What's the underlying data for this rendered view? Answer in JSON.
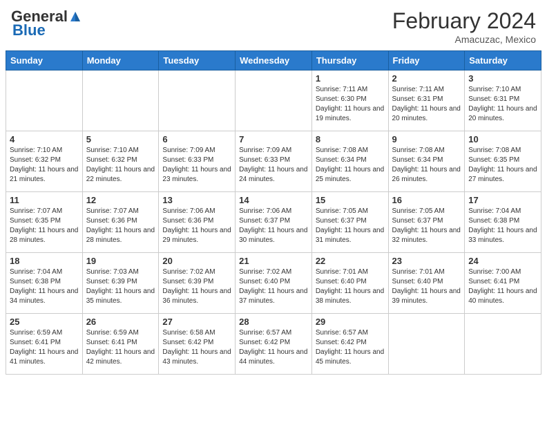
{
  "header": {
    "logo_general": "General",
    "logo_blue": "Blue",
    "title": "February 2024",
    "location": "Amacuzac, Mexico"
  },
  "days_of_week": [
    "Sunday",
    "Monday",
    "Tuesday",
    "Wednesday",
    "Thursday",
    "Friday",
    "Saturday"
  ],
  "weeks": [
    [
      {
        "day": "",
        "info": ""
      },
      {
        "day": "",
        "info": ""
      },
      {
        "day": "",
        "info": ""
      },
      {
        "day": "",
        "info": ""
      },
      {
        "day": "1",
        "info": "Sunrise: 7:11 AM\nSunset: 6:30 PM\nDaylight: 11 hours and 19 minutes."
      },
      {
        "day": "2",
        "info": "Sunrise: 7:11 AM\nSunset: 6:31 PM\nDaylight: 11 hours and 20 minutes."
      },
      {
        "day": "3",
        "info": "Sunrise: 7:10 AM\nSunset: 6:31 PM\nDaylight: 11 hours and 20 minutes."
      }
    ],
    [
      {
        "day": "4",
        "info": "Sunrise: 7:10 AM\nSunset: 6:32 PM\nDaylight: 11 hours and 21 minutes."
      },
      {
        "day": "5",
        "info": "Sunrise: 7:10 AM\nSunset: 6:32 PM\nDaylight: 11 hours and 22 minutes."
      },
      {
        "day": "6",
        "info": "Sunrise: 7:09 AM\nSunset: 6:33 PM\nDaylight: 11 hours and 23 minutes."
      },
      {
        "day": "7",
        "info": "Sunrise: 7:09 AM\nSunset: 6:33 PM\nDaylight: 11 hours and 24 minutes."
      },
      {
        "day": "8",
        "info": "Sunrise: 7:08 AM\nSunset: 6:34 PM\nDaylight: 11 hours and 25 minutes."
      },
      {
        "day": "9",
        "info": "Sunrise: 7:08 AM\nSunset: 6:34 PM\nDaylight: 11 hours and 26 minutes."
      },
      {
        "day": "10",
        "info": "Sunrise: 7:08 AM\nSunset: 6:35 PM\nDaylight: 11 hours and 27 minutes."
      }
    ],
    [
      {
        "day": "11",
        "info": "Sunrise: 7:07 AM\nSunset: 6:35 PM\nDaylight: 11 hours and 28 minutes."
      },
      {
        "day": "12",
        "info": "Sunrise: 7:07 AM\nSunset: 6:36 PM\nDaylight: 11 hours and 28 minutes."
      },
      {
        "day": "13",
        "info": "Sunrise: 7:06 AM\nSunset: 6:36 PM\nDaylight: 11 hours and 29 minutes."
      },
      {
        "day": "14",
        "info": "Sunrise: 7:06 AM\nSunset: 6:37 PM\nDaylight: 11 hours and 30 minutes."
      },
      {
        "day": "15",
        "info": "Sunrise: 7:05 AM\nSunset: 6:37 PM\nDaylight: 11 hours and 31 minutes."
      },
      {
        "day": "16",
        "info": "Sunrise: 7:05 AM\nSunset: 6:37 PM\nDaylight: 11 hours and 32 minutes."
      },
      {
        "day": "17",
        "info": "Sunrise: 7:04 AM\nSunset: 6:38 PM\nDaylight: 11 hours and 33 minutes."
      }
    ],
    [
      {
        "day": "18",
        "info": "Sunrise: 7:04 AM\nSunset: 6:38 PM\nDaylight: 11 hours and 34 minutes."
      },
      {
        "day": "19",
        "info": "Sunrise: 7:03 AM\nSunset: 6:39 PM\nDaylight: 11 hours and 35 minutes."
      },
      {
        "day": "20",
        "info": "Sunrise: 7:02 AM\nSunset: 6:39 PM\nDaylight: 11 hours and 36 minutes."
      },
      {
        "day": "21",
        "info": "Sunrise: 7:02 AM\nSunset: 6:40 PM\nDaylight: 11 hours and 37 minutes."
      },
      {
        "day": "22",
        "info": "Sunrise: 7:01 AM\nSunset: 6:40 PM\nDaylight: 11 hours and 38 minutes."
      },
      {
        "day": "23",
        "info": "Sunrise: 7:01 AM\nSunset: 6:40 PM\nDaylight: 11 hours and 39 minutes."
      },
      {
        "day": "24",
        "info": "Sunrise: 7:00 AM\nSunset: 6:41 PM\nDaylight: 11 hours and 40 minutes."
      }
    ],
    [
      {
        "day": "25",
        "info": "Sunrise: 6:59 AM\nSunset: 6:41 PM\nDaylight: 11 hours and 41 minutes."
      },
      {
        "day": "26",
        "info": "Sunrise: 6:59 AM\nSunset: 6:41 PM\nDaylight: 11 hours and 42 minutes."
      },
      {
        "day": "27",
        "info": "Sunrise: 6:58 AM\nSunset: 6:42 PM\nDaylight: 11 hours and 43 minutes."
      },
      {
        "day": "28",
        "info": "Sunrise: 6:57 AM\nSunset: 6:42 PM\nDaylight: 11 hours and 44 minutes."
      },
      {
        "day": "29",
        "info": "Sunrise: 6:57 AM\nSunset: 6:42 PM\nDaylight: 11 hours and 45 minutes."
      },
      {
        "day": "",
        "info": ""
      },
      {
        "day": "",
        "info": ""
      }
    ]
  ]
}
